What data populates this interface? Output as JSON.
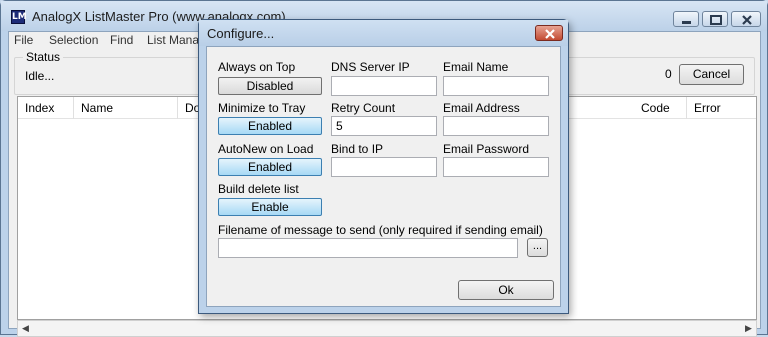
{
  "window": {
    "title": "AnalogX ListMaster Pro (www.analogx.com)",
    "icon": "LM"
  },
  "menu": [
    "File",
    "Selection",
    "Find",
    "List Mana"
  ],
  "status": {
    "legend": "Status",
    "text": "Idle...",
    "count": "0",
    "cancel_label": "Cancel"
  },
  "list": {
    "columns": [
      "Index",
      "Name",
      "Do",
      "Code",
      "Error"
    ]
  },
  "dialog": {
    "title": "Configure...",
    "always_on_top": {
      "label": "Always on Top",
      "button": "Disabled"
    },
    "minimize_to_tray": {
      "label": "Minimize to Tray",
      "button": "Enabled"
    },
    "autonew_on_load": {
      "label": "AutoNew on Load",
      "button": "Enabled"
    },
    "build_delete_list": {
      "label": "Build delete list",
      "button": "Enable"
    },
    "dns_server_ip": {
      "label": "DNS Server IP",
      "value": ""
    },
    "retry_count": {
      "label": "Retry Count",
      "value": "5"
    },
    "bind_to_ip": {
      "label": "Bind to IP",
      "value": ""
    },
    "email_name": {
      "label": "Email Name",
      "value": ""
    },
    "email_address": {
      "label": "Email Address",
      "value": ""
    },
    "email_password": {
      "label": "Email Password",
      "value": ""
    },
    "filename": {
      "label": "Filename of message to send (only required if sending email)",
      "value": ""
    },
    "browse_label": "...",
    "ok_label": "Ok"
  }
}
